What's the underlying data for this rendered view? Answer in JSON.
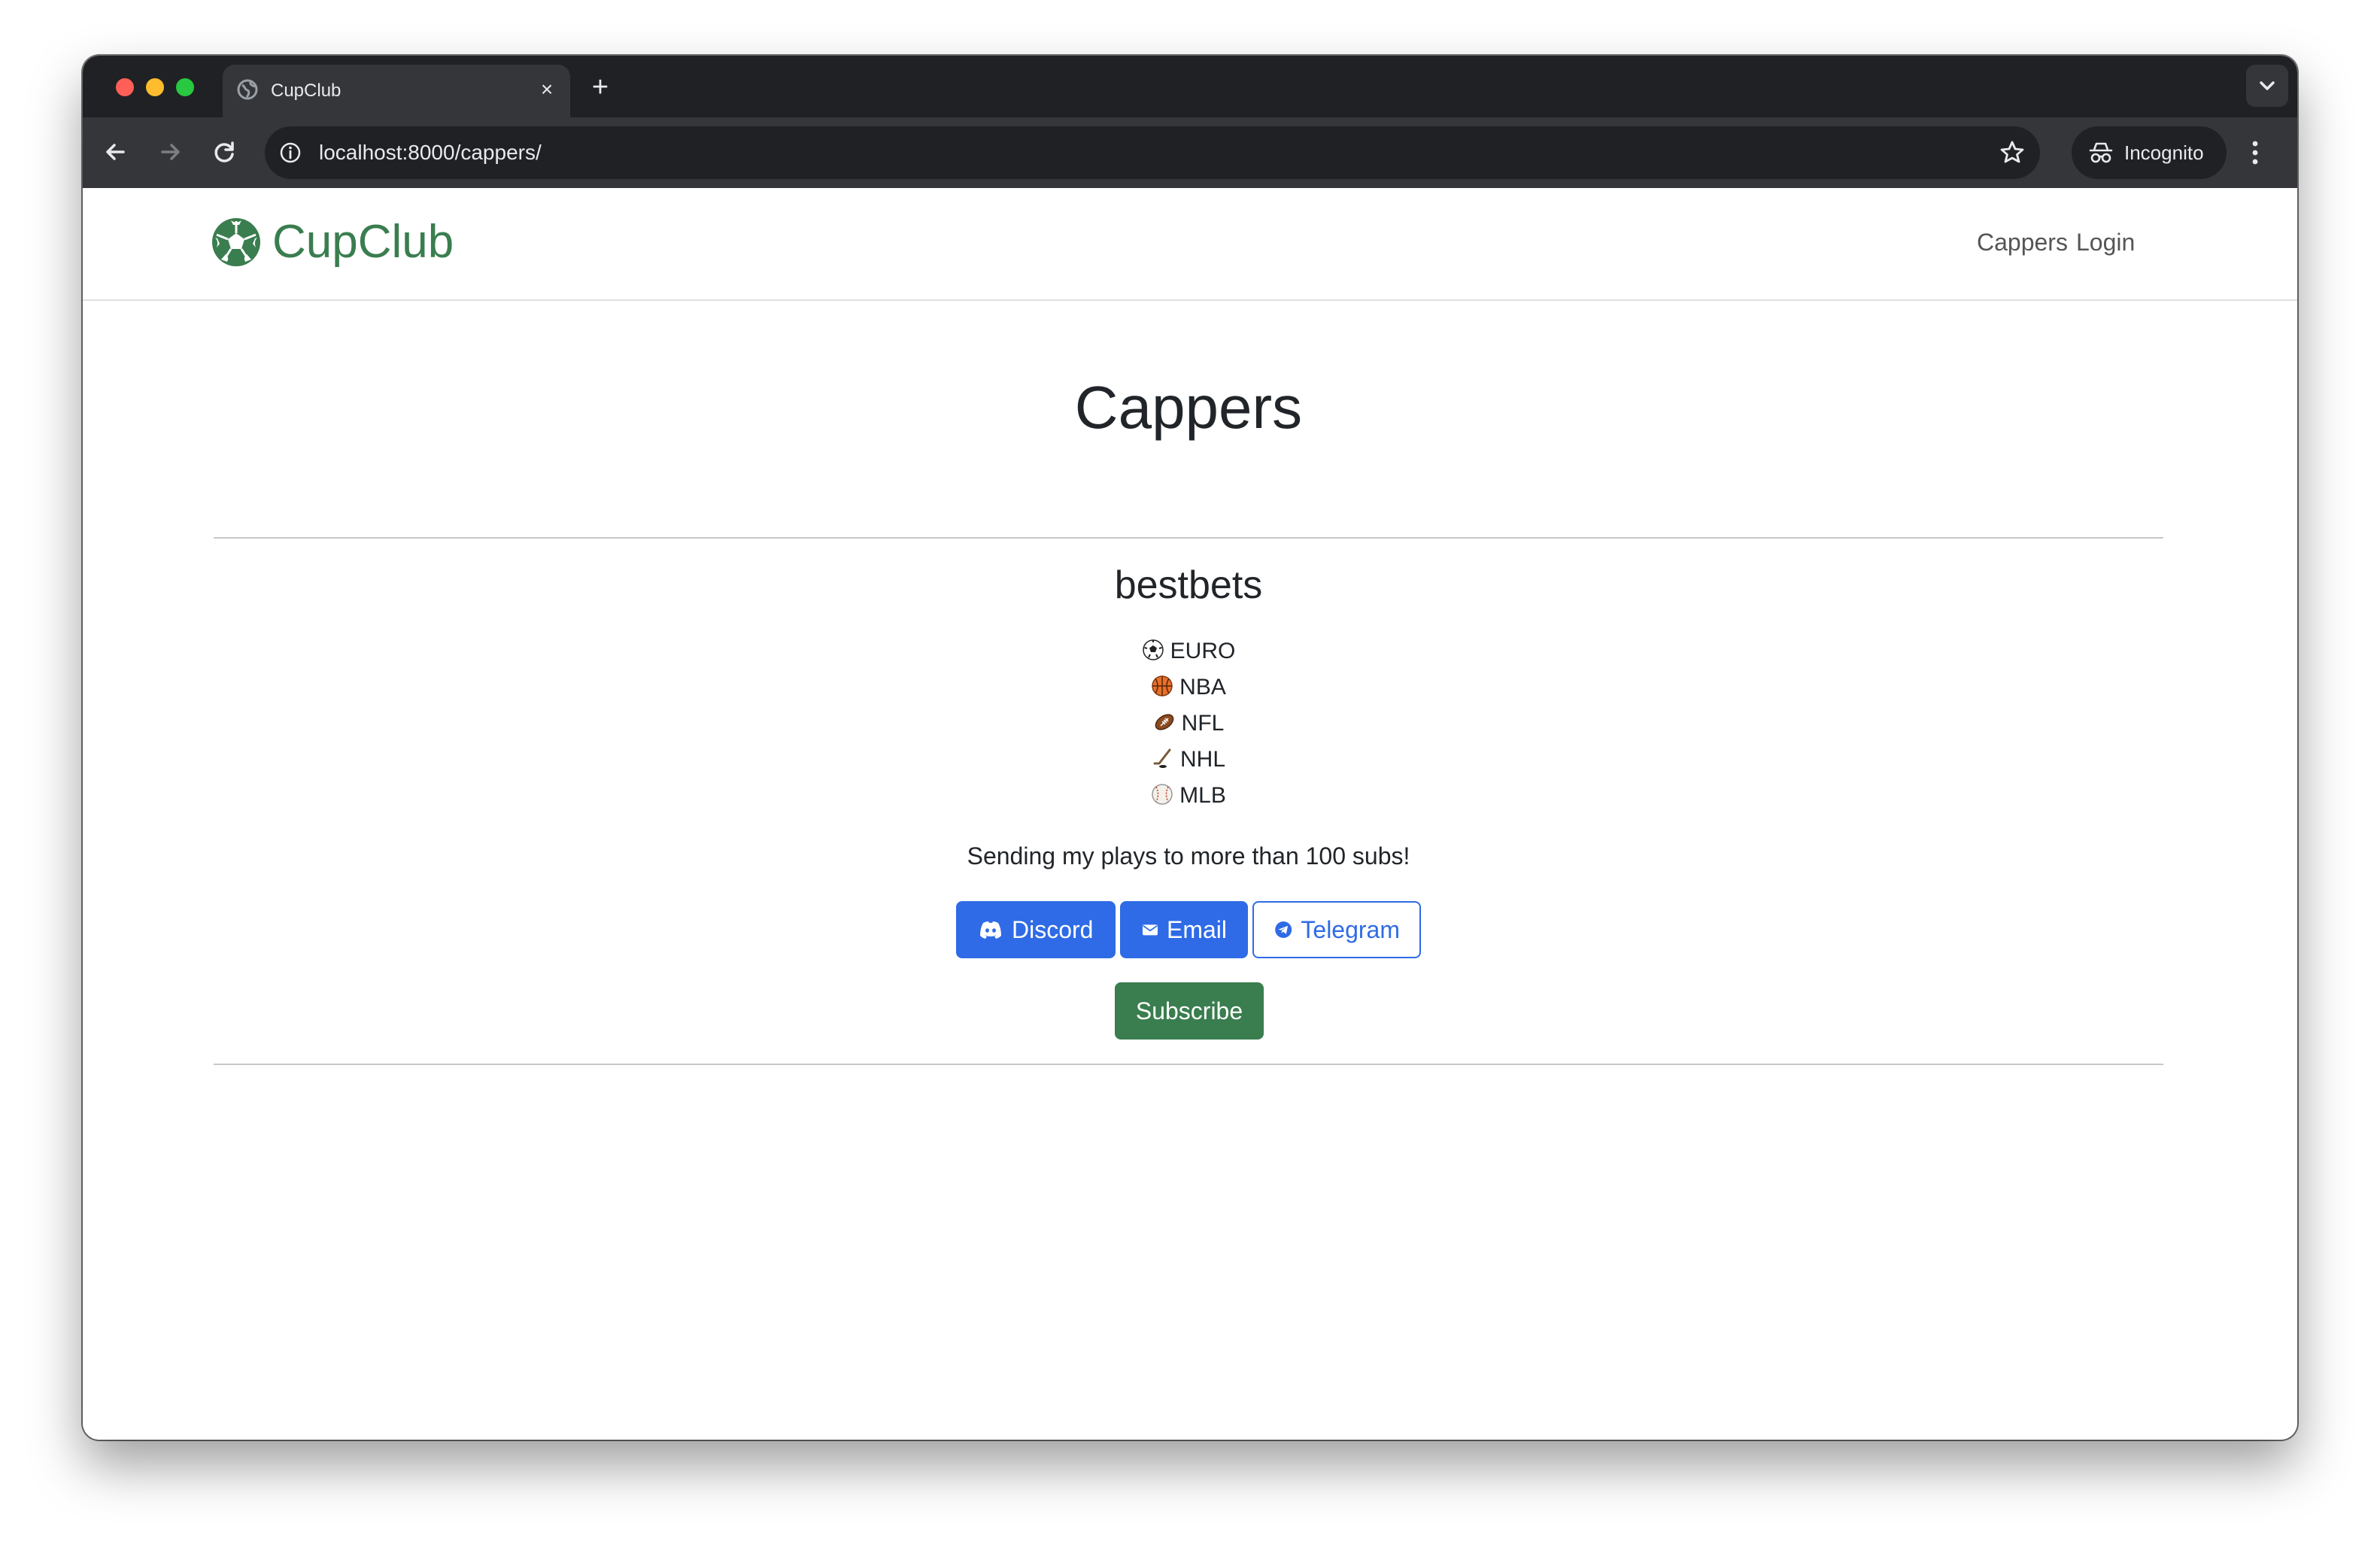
{
  "browser": {
    "tab_title": "CupClub",
    "tab_close": "×",
    "new_tab": "+",
    "url": "localhost:8000/cappers/",
    "incognito_label": "Incognito"
  },
  "site": {
    "brand": "CupClub",
    "nav": [
      {
        "label": "Cappers"
      },
      {
        "label": "Login"
      }
    ]
  },
  "page": {
    "title": "Cappers"
  },
  "capper": {
    "name": "bestbets",
    "leagues": [
      {
        "icon": "soccer-ball-icon",
        "label": "EURO"
      },
      {
        "icon": "basketball-icon",
        "label": "NBA"
      },
      {
        "icon": "football-icon",
        "label": "NFL"
      },
      {
        "icon": "hockey-stick-icon",
        "label": "NHL"
      },
      {
        "icon": "baseball-icon",
        "label": "MLB"
      }
    ],
    "tagline": "Sending my plays to more than 100 subs!",
    "channels": [
      {
        "label": "Discord",
        "style": "filled",
        "icon": "discord-icon"
      },
      {
        "label": "Email",
        "style": "filled",
        "icon": "envelope-icon"
      },
      {
        "label": "Telegram",
        "style": "outline",
        "icon": "telegram-icon"
      }
    ],
    "subscribe_label": "Subscribe"
  },
  "colors": {
    "brand_green": "#3a7d4f",
    "primary_blue": "#2f6be6",
    "browser_dark": "#202124",
    "toolbar": "#35363a"
  }
}
